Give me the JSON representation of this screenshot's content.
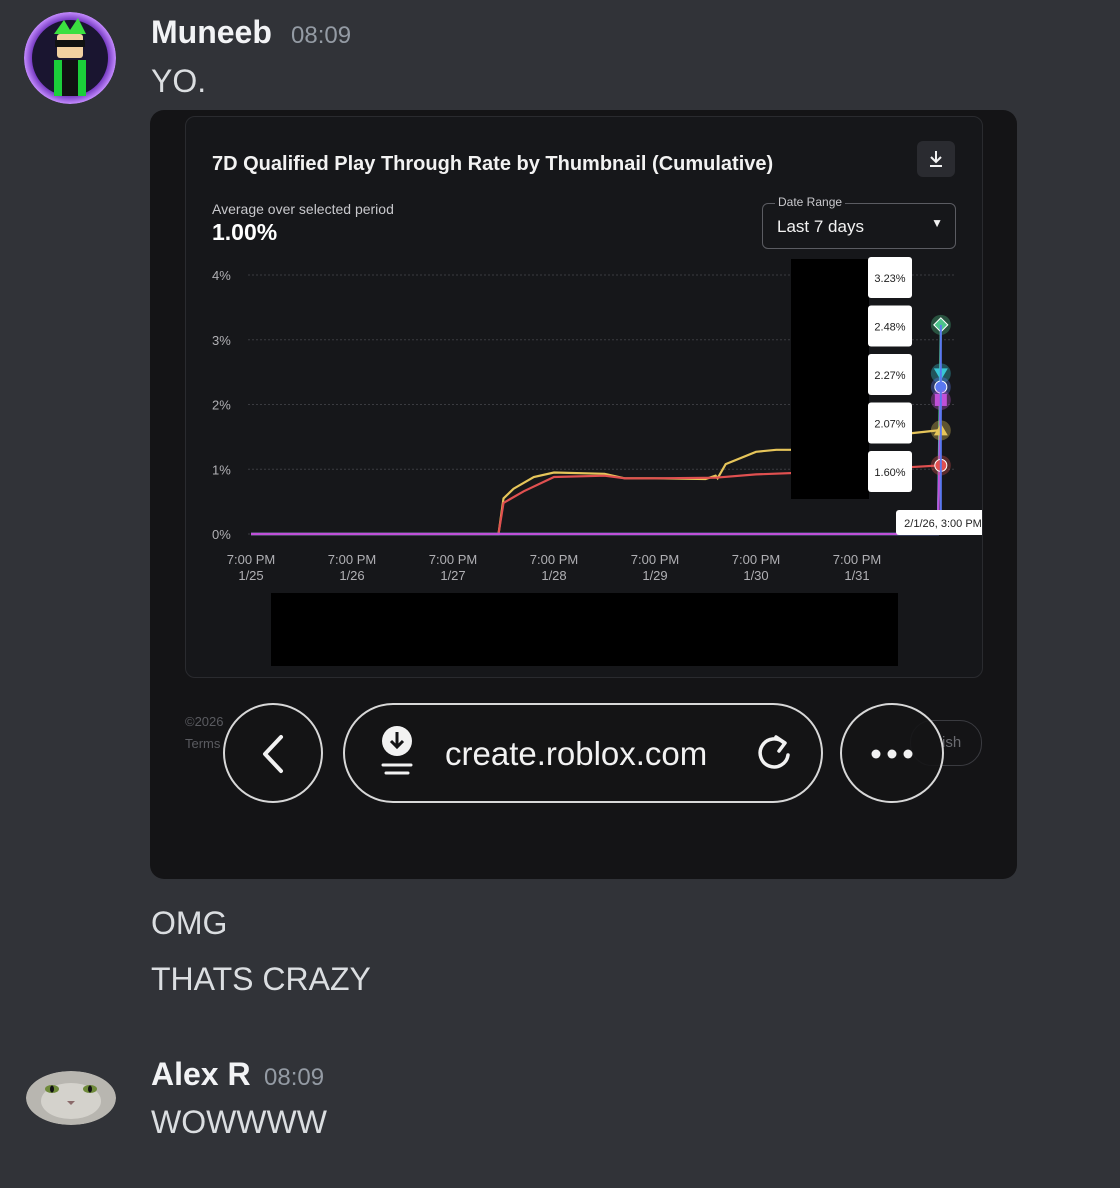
{
  "messages": [
    {
      "author": "Muneeb",
      "time": "08:09",
      "lines": [
        "YO.",
        "OMG",
        "THATS CRAZY"
      ]
    },
    {
      "author": "Alex R",
      "time": "08:09",
      "lines": [
        "WOWWWW"
      ]
    }
  ],
  "screenshot": {
    "chart_title": "7D Qualified Play Through Rate by Thumbnail (Cumulative)",
    "average_label": "Average over selected period",
    "average_value": "1.00%",
    "date_range_label": "Date Range",
    "date_range_value": "Last 7 days",
    "tooltip_values": [
      "3.23%",
      "2.48%",
      "2.27%",
      "2.07%",
      "1.60%"
    ],
    "hover_date": "2/1/26, 3:00 PM",
    "footer_copyright": "©2026",
    "footer_terms": "Terms",
    "publish_label": "ish",
    "url": "create.roblox.com"
  },
  "chart_data": {
    "type": "line",
    "x_tick_labels": [
      [
        "7:00 PM",
        "1/25"
      ],
      [
        "7:00 PM",
        "1/26"
      ],
      [
        "7:00 PM",
        "1/27"
      ],
      [
        "7:00 PM",
        "1/28"
      ],
      [
        "7:00 PM",
        "1/29"
      ],
      [
        "7:00 PM",
        "1/30"
      ],
      [
        "7:00 PM",
        "1/31"
      ]
    ],
    "y_tick_labels": [
      "4%",
      "3%",
      "2%",
      "1%",
      "0%"
    ],
    "ylim": [
      0,
      4
    ],
    "x_units": "days since 1/25 7:00 PM",
    "xlim": [
      0,
      6.83
    ],
    "grid": true,
    "series": [
      {
        "color": "#e6c55a",
        "marker": "triangle",
        "points": [
          [
            0,
            0
          ],
          [
            2.45,
            0
          ],
          [
            2.5,
            0.55
          ],
          [
            2.6,
            0.7
          ],
          [
            2.8,
            0.88
          ],
          [
            3.0,
            0.95
          ],
          [
            3.5,
            0.93
          ],
          [
            3.7,
            0.86
          ],
          [
            4.0,
            0.86
          ],
          [
            4.5,
            0.85
          ],
          [
            4.6,
            0.9
          ],
          [
            4.62,
            0.86
          ],
          [
            4.7,
            1.08
          ],
          [
            5.0,
            1.27
          ],
          [
            5.2,
            1.3
          ],
          [
            5.4,
            1.3
          ],
          [
            6.0,
            1.45
          ],
          [
            6.5,
            1.55
          ],
          [
            6.8,
            1.6
          ],
          [
            6.83,
            1.6
          ]
        ]
      },
      {
        "color": "#e05050",
        "marker": "circle",
        "points": [
          [
            0,
            0
          ],
          [
            2.45,
            0
          ],
          [
            2.5,
            0.48
          ],
          [
            2.7,
            0.66
          ],
          [
            3.0,
            0.88
          ],
          [
            3.5,
            0.9
          ],
          [
            3.7,
            0.86
          ],
          [
            4.0,
            0.86
          ],
          [
            4.6,
            0.87
          ],
          [
            5.0,
            0.92
          ],
          [
            5.5,
            0.95
          ],
          [
            6.5,
            1.03
          ],
          [
            6.83,
            1.06
          ]
        ]
      },
      {
        "color": "#4cc38a",
        "marker": "diamond",
        "points": [
          [
            0,
            0
          ],
          [
            6.8,
            0
          ],
          [
            6.83,
            3.23
          ]
        ]
      },
      {
        "color": "#38c6d6",
        "marker": "triangle-down",
        "points": [
          [
            0,
            0
          ],
          [
            6.8,
            0
          ],
          [
            6.83,
            2.48
          ]
        ]
      },
      {
        "color": "#5a78f0",
        "marker": "circle",
        "points": [
          [
            0,
            0
          ],
          [
            6.8,
            0
          ],
          [
            6.83,
            2.27
          ]
        ]
      },
      {
        "color": "#c050d8",
        "marker": "square",
        "points": [
          [
            0,
            0
          ],
          [
            6.8,
            0
          ],
          [
            6.83,
            2.07
          ]
        ]
      }
    ]
  }
}
